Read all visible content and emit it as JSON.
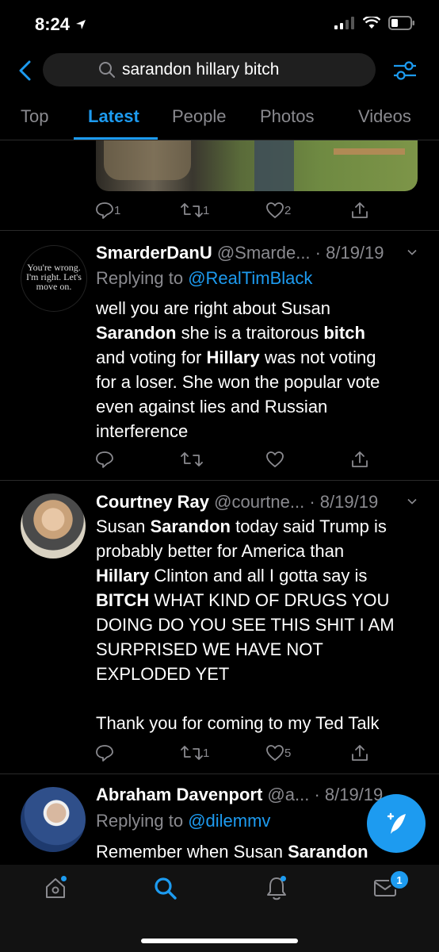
{
  "status": {
    "time": "8:24"
  },
  "search": {
    "query": "sarandon hillary bitch"
  },
  "tabs": [
    {
      "label": "Top"
    },
    {
      "label": "Latest"
    },
    {
      "label": "People"
    },
    {
      "label": "Photos"
    },
    {
      "label": "Videos"
    }
  ],
  "prev_tweet": {
    "reply_count": "1",
    "retweet_count": "1",
    "like_count": "2"
  },
  "tweets": [
    {
      "name": "SmarderDanU",
      "handle": "@Smarde...",
      "date": "· 8/19/19",
      "replying_prefix": "Replying to ",
      "replying_to": "@RealTimBlack",
      "avatar_text": "You're wrong. I'm right. Let's move on.",
      "body": [
        "well you are right about Susan",
        "Sarandon she is a traitorous bitch",
        "and voting for Hillary was not voting",
        "for a loser. She won the popular vote",
        "even against lies and Russian",
        "interference"
      ],
      "reply_count": "",
      "retweet_count": "",
      "like_count": ""
    },
    {
      "name": "Courtney Ray",
      "handle": "@courtne...",
      "date": "· 8/19/19",
      "body": [
        "Susan Sarandon today said Trump is",
        "probably better for America than",
        "Hillary Clinton and all I gotta say is",
        "BITCH WHAT KIND OF DRUGS YOU",
        "DOING DO YOU SEE THIS SHIT I AM",
        "SURPRISED WE HAVE NOT",
        "EXPLODED YET",
        "",
        "Thank you for coming to my Ted Talk"
      ],
      "reply_count": "",
      "retweet_count": "1",
      "like_count": "5"
    },
    {
      "name": "Abraham Davenport",
      "handle": "@a...",
      "date": "· 8/19/19",
      "replying_prefix": "Replying to ",
      "replying_to": "@dilemmv",
      "body": [
        "Remember when Susan Sarandon"
      ]
    }
  ],
  "bottom_nav": {
    "messages_badge": "1"
  },
  "colors": {
    "accent": "#1d9bf0",
    "muted": "#8a8a8f",
    "background": "#000000"
  }
}
